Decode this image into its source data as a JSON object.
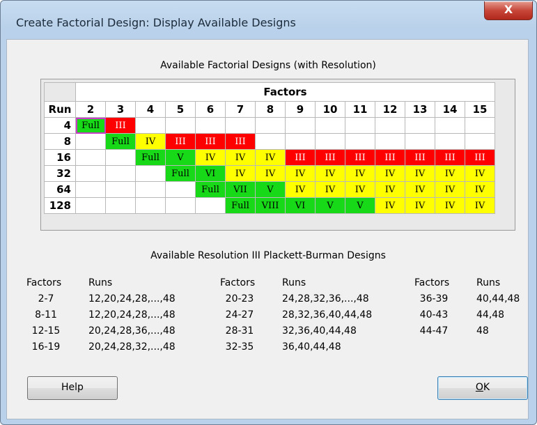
{
  "window": {
    "title": "Create Factorial Design: Display Available Designs",
    "close_label": "X"
  },
  "designs": {
    "heading": "Available Factorial Designs (with Resolution)",
    "factors_header": "Factors",
    "run_header": "Run",
    "factors": [
      "2",
      "3",
      "4",
      "5",
      "6",
      "7",
      "8",
      "9",
      "10",
      "11",
      "12",
      "13",
      "14",
      "15"
    ],
    "rows": [
      {
        "run": "4",
        "cells": [
          [
            "Full",
            "g"
          ],
          [
            "III",
            "r"
          ],
          [
            "",
            "w"
          ],
          [
            "",
            "w"
          ],
          [
            "",
            "w"
          ],
          [
            "",
            "w"
          ],
          [
            "",
            "w"
          ],
          [
            "",
            "w"
          ],
          [
            "",
            "w"
          ],
          [
            "",
            "w"
          ],
          [
            "",
            "w"
          ],
          [
            "",
            "w"
          ],
          [
            "",
            "w"
          ],
          [
            "",
            "w"
          ]
        ]
      },
      {
        "run": "8",
        "cells": [
          [
            "",
            "w"
          ],
          [
            "Full",
            "g"
          ],
          [
            "IV",
            "y"
          ],
          [
            "III",
            "r"
          ],
          [
            "III",
            "r"
          ],
          [
            "III",
            "r"
          ],
          [
            "",
            "w"
          ],
          [
            "",
            "w"
          ],
          [
            "",
            "w"
          ],
          [
            "",
            "w"
          ],
          [
            "",
            "w"
          ],
          [
            "",
            "w"
          ],
          [
            "",
            "w"
          ],
          [
            "",
            "w"
          ]
        ]
      },
      {
        "run": "16",
        "cells": [
          [
            "",
            "w"
          ],
          [
            "",
            "w"
          ],
          [
            "Full",
            "g"
          ],
          [
            "V",
            "g"
          ],
          [
            "IV",
            "y"
          ],
          [
            "IV",
            "y"
          ],
          [
            "IV",
            "y"
          ],
          [
            "III",
            "r"
          ],
          [
            "III",
            "r"
          ],
          [
            "III",
            "r"
          ],
          [
            "III",
            "r"
          ],
          [
            "III",
            "r"
          ],
          [
            "III",
            "r"
          ],
          [
            "III",
            "r"
          ]
        ]
      },
      {
        "run": "32",
        "cells": [
          [
            "",
            "w"
          ],
          [
            "",
            "w"
          ],
          [
            "",
            "w"
          ],
          [
            "Full",
            "g"
          ],
          [
            "VI",
            "g"
          ],
          [
            "IV",
            "y"
          ],
          [
            "IV",
            "y"
          ],
          [
            "IV",
            "y"
          ],
          [
            "IV",
            "y"
          ],
          [
            "IV",
            "y"
          ],
          [
            "IV",
            "y"
          ],
          [
            "IV",
            "y"
          ],
          [
            "IV",
            "y"
          ],
          [
            "IV",
            "y"
          ]
        ]
      },
      {
        "run": "64",
        "cells": [
          [
            "",
            "w"
          ],
          [
            "",
            "w"
          ],
          [
            "",
            "w"
          ],
          [
            "",
            "w"
          ],
          [
            "Full",
            "g"
          ],
          [
            "VII",
            "g"
          ],
          [
            "V",
            "g"
          ],
          [
            "IV",
            "y"
          ],
          [
            "IV",
            "y"
          ],
          [
            "IV",
            "y"
          ],
          [
            "IV",
            "y"
          ],
          [
            "IV",
            "y"
          ],
          [
            "IV",
            "y"
          ],
          [
            "IV",
            "y"
          ]
        ]
      },
      {
        "run": "128",
        "cells": [
          [
            "",
            "w"
          ],
          [
            "",
            "w"
          ],
          [
            "",
            "w"
          ],
          [
            "",
            "w"
          ],
          [
            "",
            "w"
          ],
          [
            "Full",
            "g"
          ],
          [
            "VIII",
            "g"
          ],
          [
            "VI",
            "g"
          ],
          [
            "V",
            "g"
          ],
          [
            "V",
            "g"
          ],
          [
            "IV",
            "y"
          ],
          [
            "IV",
            "y"
          ],
          [
            "IV",
            "y"
          ],
          [
            "IV",
            "y"
          ]
        ]
      }
    ],
    "colors": {
      "green": "#17d917",
      "yellow": "#ffff00",
      "red": "#ff0000"
    }
  },
  "plackett_burman": {
    "heading": "Available Resolution III Plackett-Burman Designs",
    "columns": [
      {
        "factors_label": "Factors",
        "runs_label": "Runs",
        "items": [
          [
            "2-7",
            "12,20,24,28,...,48"
          ],
          [
            "8-11",
            "12,20,24,28,...,48"
          ],
          [
            "12-15",
            "20,24,28,36,...,48"
          ],
          [
            "16-19",
            "20,24,28,32,...,48"
          ]
        ]
      },
      {
        "factors_label": "Factors",
        "runs_label": "Runs",
        "items": [
          [
            "20-23",
            "24,28,32,36,...,48"
          ],
          [
            "24-27",
            "28,32,36,40,44,48"
          ],
          [
            "28-31",
            "32,36,40,44,48"
          ],
          [
            "32-35",
            "36,40,44,48"
          ]
        ]
      },
      {
        "factors_label": "Factors",
        "runs_label": "Runs",
        "items": [
          [
            "36-39",
            "40,44,48"
          ],
          [
            "40-43",
            "44,48"
          ],
          [
            "44-47",
            "48"
          ]
        ]
      }
    ]
  },
  "buttons": {
    "help": "Help",
    "ok_underlined": "O",
    "ok_rest": "K"
  }
}
